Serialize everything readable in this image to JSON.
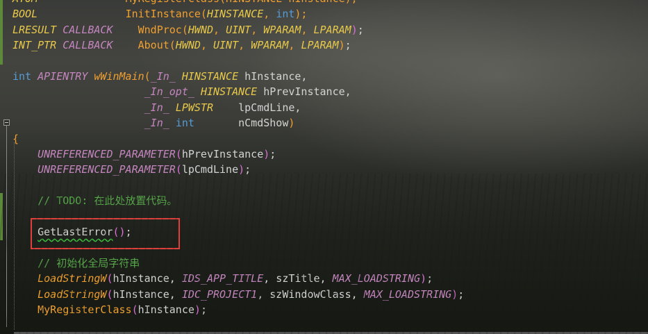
{
  "editor": {
    "lines": [
      [
        {
          "c": "t",
          "s": "ATOM"
        },
        {
          "c": "p",
          "s": "              "
        },
        {
          "c": "f",
          "s": "MyRegisterClass(HINSTANCE hInstance);"
        }
      ],
      [
        {
          "c": "t",
          "s": "BOOL"
        },
        {
          "c": "p",
          "s": "              "
        },
        {
          "c": "f",
          "s": "InitInstance("
        },
        {
          "c": "t",
          "s": "HINSTANCE"
        },
        {
          "c": "f",
          "s": ", "
        },
        {
          "c": "k",
          "s": "int"
        },
        {
          "c": "f",
          "s": ");"
        }
      ],
      [
        {
          "c": "t",
          "s": "LRESULT"
        },
        {
          "c": "p",
          "s": " "
        },
        {
          "c": "m",
          "s": "CALLBACK"
        },
        {
          "c": "p",
          "s": "    "
        },
        {
          "c": "f",
          "s": "WndProc("
        },
        {
          "c": "t",
          "s": "HWND"
        },
        {
          "c": "f",
          "s": ", "
        },
        {
          "c": "t",
          "s": "UINT"
        },
        {
          "c": "f",
          "s": ", "
        },
        {
          "c": "t",
          "s": "WPARAM"
        },
        {
          "c": "f",
          "s": ", "
        },
        {
          "c": "t",
          "s": "LPARAM"
        },
        {
          "c": "br",
          "s": ")"
        },
        {
          "c": "p",
          "s": ";"
        }
      ],
      [
        {
          "c": "t",
          "s": "INT_PTR"
        },
        {
          "c": "p",
          "s": " "
        },
        {
          "c": "m",
          "s": "CALLBACK"
        },
        {
          "c": "p",
          "s": "    "
        },
        {
          "c": "f",
          "s": "About("
        },
        {
          "c": "t",
          "s": "HWND"
        },
        {
          "c": "f",
          "s": ", "
        },
        {
          "c": "t",
          "s": "UINT"
        },
        {
          "c": "f",
          "s": ", "
        },
        {
          "c": "t",
          "s": "WPARAM"
        },
        {
          "c": "f",
          "s": ", "
        },
        {
          "c": "t",
          "s": "LPARAM"
        },
        {
          "c": "f",
          "s": ")"
        },
        {
          "c": "p",
          "s": ";"
        }
      ],
      [],
      [
        {
          "c": "k",
          "s": "int"
        },
        {
          "c": "p",
          "s": " "
        },
        {
          "c": "m",
          "s": "APIENTRY"
        },
        {
          "c": "p",
          "s": " "
        },
        {
          "c": "fi",
          "s": "wWinMain"
        },
        {
          "c": "f",
          "s": "("
        },
        {
          "c": "m",
          "s": "_In_"
        },
        {
          "c": "p",
          "s": " "
        },
        {
          "c": "t",
          "s": "HINSTANCE"
        },
        {
          "c": "p",
          "s": " hInstance,"
        }
      ],
      [
        {
          "c": "p",
          "s": "                     "
        },
        {
          "c": "m",
          "s": "_In_opt_"
        },
        {
          "c": "p",
          "s": " "
        },
        {
          "c": "t",
          "s": "HINSTANCE"
        },
        {
          "c": "p",
          "s": " hPrevInstance,"
        }
      ],
      [
        {
          "c": "p",
          "s": "                     "
        },
        {
          "c": "m",
          "s": "_In_"
        },
        {
          "c": "p",
          "s": " "
        },
        {
          "c": "t",
          "s": "LPWSTR"
        },
        {
          "c": "p",
          "s": "    lpCmdLine,"
        }
      ],
      [
        {
          "c": "p",
          "s": "                     "
        },
        {
          "c": "m",
          "s": "_In_"
        },
        {
          "c": "p",
          "s": " "
        },
        {
          "c": "k",
          "s": "int"
        },
        {
          "c": "p",
          "s": "       nCmdShow"
        },
        {
          "c": "f",
          "s": ")"
        }
      ],
      [
        {
          "c": "f",
          "s": "{"
        }
      ],
      [
        {
          "c": "p",
          "s": "    "
        },
        {
          "c": "m",
          "s": "UNREFERENCED_PARAMETER"
        },
        {
          "c": "br",
          "s": "("
        },
        {
          "c": "p",
          "s": "hPrevInstance"
        },
        {
          "c": "br",
          "s": ")"
        },
        {
          "c": "p",
          "s": ";"
        }
      ],
      [
        {
          "c": "p",
          "s": "    "
        },
        {
          "c": "m",
          "s": "UNREFERENCED_PARAMETER"
        },
        {
          "c": "br",
          "s": "("
        },
        {
          "c": "p",
          "s": "lpCmdLine"
        },
        {
          "c": "br",
          "s": ")"
        },
        {
          "c": "p",
          "s": ";"
        }
      ],
      [],
      [
        {
          "c": "p",
          "s": "    "
        },
        {
          "c": "c",
          "s": "// TODO: 在此处放置代码。"
        }
      ],
      [],
      [
        {
          "c": "p",
          "s": "    "
        },
        {
          "c": "sq",
          "s": "GetLastError"
        },
        {
          "c": "br",
          "s": "()"
        },
        {
          "c": "p",
          "s": ";"
        }
      ],
      [],
      [
        {
          "c": "p",
          "s": "    "
        },
        {
          "c": "c",
          "s": "// 初始化全局字符串"
        }
      ],
      [
        {
          "c": "p",
          "s": "    "
        },
        {
          "c": "fi",
          "s": "LoadStringW"
        },
        {
          "c": "br",
          "s": "("
        },
        {
          "c": "p",
          "s": "hInstance, "
        },
        {
          "c": "m",
          "s": "IDS_APP_TITLE"
        },
        {
          "c": "p",
          "s": ", szTitle, "
        },
        {
          "c": "m",
          "s": "MAX_LOADSTRING"
        },
        {
          "c": "br",
          "s": ")"
        },
        {
          "c": "p",
          "s": ";"
        }
      ],
      [
        {
          "c": "p",
          "s": "    "
        },
        {
          "c": "fi",
          "s": "LoadStringW"
        },
        {
          "c": "br",
          "s": "("
        },
        {
          "c": "p",
          "s": "hInstance, "
        },
        {
          "c": "m",
          "s": "IDC_PROJECT1"
        },
        {
          "c": "p",
          "s": ", szWindowClass, "
        },
        {
          "c": "m",
          "s": "MAX_LOADSTRING"
        },
        {
          "c": "br",
          "s": ")"
        },
        {
          "c": "p",
          "s": ";"
        }
      ],
      [
        {
          "c": "p",
          "s": "    "
        },
        {
          "c": "f",
          "s": "MyRegisterClass"
        },
        {
          "c": "br",
          "s": "("
        },
        {
          "c": "p",
          "s": "hInstance"
        },
        {
          "c": "br",
          "s": ")"
        },
        {
          "c": "p",
          "s": ";"
        }
      ]
    ]
  }
}
